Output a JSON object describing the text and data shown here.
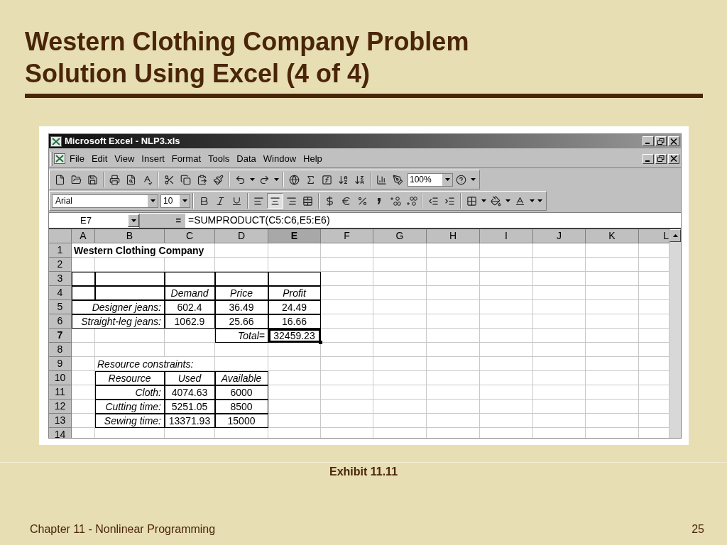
{
  "slide": {
    "title_lines": [
      "Western Clothing Company Problem",
      "Solution Using Excel (4 of 4)"
    ],
    "caption": "Exhibit 11.11",
    "footer_left": "Chapter 11 - Nonlinear Programming",
    "page_number": "25"
  },
  "excel": {
    "title": "Microsoft Excel - NLP3.xls",
    "menu": [
      "File",
      "Edit",
      "View",
      "Insert",
      "Format",
      "Tools",
      "Data",
      "Window",
      "Help"
    ],
    "zoom": "100%",
    "font_name": "Arial",
    "font_size": "10",
    "alignment": [
      {
        "pressed": false
      },
      {
        "pressed": true
      },
      {
        "pressed": false
      }
    ],
    "name_box": "E7",
    "equals": "=",
    "formula": "=SUMPRODUCT(C5:C6,E5:E6)",
    "columns": [
      {
        "label": "A",
        "selected": false
      },
      {
        "label": "B",
        "selected": false
      },
      {
        "label": "C",
        "selected": false
      },
      {
        "label": "D",
        "selected": false
      },
      {
        "label": "E",
        "selected": true
      },
      {
        "label": "F",
        "selected": false
      },
      {
        "label": "G",
        "selected": false
      },
      {
        "label": "H",
        "selected": false
      },
      {
        "label": "I",
        "selected": false
      },
      {
        "label": "J",
        "selected": false
      },
      {
        "label": "K",
        "selected": false
      },
      {
        "label": "L",
        "selected": false
      }
    ],
    "rows": [
      {
        "number": "1",
        "selected": false,
        "cells": [
          {
            "boxed": false,
            "text": "Western Clothing Company",
            "kind": "title"
          }
        ]
      },
      {
        "number": "2",
        "selected": false,
        "cells": []
      },
      {
        "number": "3",
        "selected": false,
        "cells": [
          {
            "boxed": true
          },
          {
            "boxed": true
          },
          {
            "boxed": true
          },
          {
            "boxed": true
          },
          {
            "boxed": true
          }
        ]
      },
      {
        "number": "4",
        "selected": false,
        "cells": [
          {
            "boxed": true
          },
          {
            "boxed": true
          },
          {
            "boxed": true,
            "text": "Demand",
            "kind": "heading"
          },
          {
            "boxed": true,
            "text": "Price",
            "kind": "heading"
          },
          {
            "boxed": true,
            "text": "Profit",
            "kind": "heading"
          }
        ]
      },
      {
        "number": "5",
        "selected": false,
        "cells": [
          {
            "boxed": true
          },
          {
            "boxed": true,
            "text": "Designer jeans:",
            "kind": "label"
          },
          {
            "boxed": true,
            "text": "602.4",
            "kind": "number"
          },
          {
            "boxed": true,
            "text": "36.49",
            "kind": "number"
          },
          {
            "boxed": true,
            "text": "24.49",
            "kind": "number"
          }
        ]
      },
      {
        "number": "6",
        "selected": false,
        "cells": [
          {
            "boxed": true
          },
          {
            "boxed": true,
            "text": "Straight-leg jeans:",
            "kind": "label"
          },
          {
            "boxed": true,
            "text": "1062.9",
            "kind": "number"
          },
          {
            "boxed": true,
            "text": "25.66",
            "kind": "number"
          },
          {
            "boxed": true,
            "text": "16.66",
            "kind": "number"
          }
        ]
      },
      {
        "number": "7",
        "selected": true,
        "cells": [
          {
            "boxed": false
          },
          {
            "boxed": false
          },
          {
            "boxed": false
          },
          {
            "boxed": true,
            "text": "Total=",
            "kind": "label"
          },
          {
            "boxed": true,
            "text": "32459.23",
            "kind": "number"
          }
        ]
      },
      {
        "number": "8",
        "selected": false,
        "cells": []
      },
      {
        "number": "9",
        "selected": false,
        "cells": [
          {
            "boxed": false
          },
          {
            "boxed": false,
            "text": "Resource constraints:",
            "kind": "note"
          }
        ]
      },
      {
        "number": "10",
        "selected": false,
        "cells": [
          {
            "boxed": false
          },
          {
            "boxed": true,
            "text": "Resource",
            "kind": "heading"
          },
          {
            "boxed": true,
            "text": "Used",
            "kind": "heading"
          },
          {
            "boxed": true,
            "text": "Available",
            "kind": "heading"
          }
        ]
      },
      {
        "number": "11",
        "selected": false,
        "cells": [
          {
            "boxed": false
          },
          {
            "boxed": true,
            "text": "Cloth:",
            "kind": "label"
          },
          {
            "boxed": true,
            "text": "4074.63",
            "kind": "number"
          },
          {
            "boxed": true,
            "text": "6000",
            "kind": "number"
          }
        ]
      },
      {
        "number": "12",
        "selected": false,
        "cells": [
          {
            "boxed": false
          },
          {
            "boxed": true,
            "text": "Cutting time:",
            "kind": "label"
          },
          {
            "boxed": true,
            "text": "5251.05",
            "kind": "number"
          },
          {
            "boxed": true,
            "text": "8500",
            "kind": "number"
          }
        ]
      },
      {
        "number": "13",
        "selected": false,
        "cells": [
          {
            "boxed": false
          },
          {
            "boxed": true,
            "text": "Sewing time:",
            "kind": "label"
          },
          {
            "boxed": true,
            "text": "13371.93",
            "kind": "number"
          },
          {
            "boxed": true,
            "text": "15000",
            "kind": "number"
          }
        ]
      },
      {
        "number": "14",
        "selected": false,
        "cells": []
      }
    ]
  }
}
